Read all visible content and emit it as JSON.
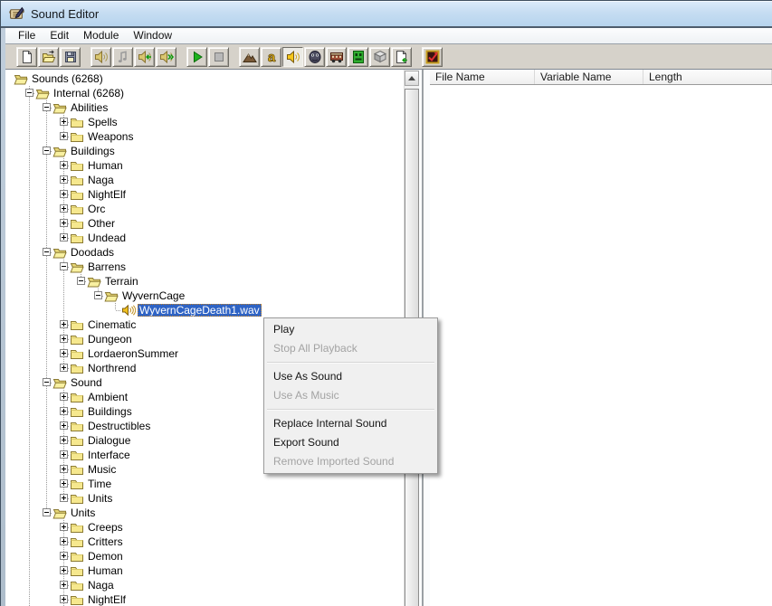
{
  "window": {
    "title": "Sound Editor"
  },
  "menu_bar": {
    "items": [
      "File",
      "Edit",
      "Module",
      "Window"
    ]
  },
  "toolbar": {
    "groups": [
      {
        "buttons": [
          {
            "name": "new-button",
            "icon": "new-document-icon",
            "pressed": false
          },
          {
            "name": "open-button",
            "icon": "open-file-icon",
            "pressed": false
          },
          {
            "name": "save-button",
            "icon": "save-icon",
            "pressed": false
          }
        ]
      },
      {
        "buttons": [
          {
            "name": "play-sound-button",
            "icon": "play-sound-icon",
            "pressed": false
          },
          {
            "name": "play-note-button",
            "icon": "music-note-icon",
            "pressed": false
          },
          {
            "name": "prev-sound-button",
            "icon": "speaker-back-icon",
            "pressed": false
          },
          {
            "name": "next-sound-button",
            "icon": "speaker-forward-icon",
            "pressed": false
          }
        ]
      },
      {
        "buttons": [
          {
            "name": "play-button",
            "icon": "play-icon",
            "pressed": false
          },
          {
            "name": "stop-button",
            "icon": "stop-icon",
            "pressed": false
          }
        ]
      },
      {
        "buttons": [
          {
            "name": "terrain-editor-button",
            "icon": "terrain-editor-icon",
            "pressed": false
          },
          {
            "name": "trigger-editor-button",
            "icon": "trigger-editor-icon",
            "pressed": false
          },
          {
            "name": "sound-editor-button",
            "icon": "sound-editor-icon",
            "pressed": true
          },
          {
            "name": "object-editor-button",
            "icon": "object-editor-icon",
            "pressed": false
          },
          {
            "name": "campaign-editor-button",
            "icon": "campaign-editor-icon",
            "pressed": false
          },
          {
            "name": "ai-editor-button",
            "icon": "ai-editor-icon",
            "pressed": false
          },
          {
            "name": "object-manager-button",
            "icon": "object-manager-icon",
            "pressed": false
          },
          {
            "name": "import-manager-button",
            "icon": "import-manager-icon",
            "pressed": false
          }
        ]
      },
      {
        "buttons": [
          {
            "name": "test-map-button",
            "icon": "test-map-icon",
            "pressed": false
          }
        ]
      }
    ]
  },
  "tree": {
    "trailing_levels": [
      1,
      3
    ],
    "rows": [
      {
        "label": "Sounds (6268)",
        "level": 0,
        "icon": "folder-open",
        "expander": "none",
        "selected": false
      },
      {
        "label": "Internal (6268)",
        "level": 1,
        "icon": "folder-open",
        "expander": "minus",
        "selected": false
      },
      {
        "label": "Abilities",
        "level": 2,
        "icon": "folder-open",
        "expander": "minus",
        "selected": false
      },
      {
        "label": "Spells",
        "level": 3,
        "icon": "folder-closed",
        "expander": "plus",
        "selected": false
      },
      {
        "label": "Weapons",
        "level": 3,
        "icon": "folder-closed",
        "expander": "plus",
        "selected": false
      },
      {
        "label": "Buildings",
        "level": 2,
        "icon": "folder-open",
        "expander": "minus",
        "selected": false
      },
      {
        "label": "Human",
        "level": 3,
        "icon": "folder-closed",
        "expander": "plus",
        "selected": false
      },
      {
        "label": "Naga",
        "level": 3,
        "icon": "folder-closed",
        "expander": "plus",
        "selected": false
      },
      {
        "label": "NightElf",
        "level": 3,
        "icon": "folder-closed",
        "expander": "plus",
        "selected": false
      },
      {
        "label": "Orc",
        "level": 3,
        "icon": "folder-closed",
        "expander": "plus",
        "selected": false
      },
      {
        "label": "Other",
        "level": 3,
        "icon": "folder-closed",
        "expander": "plus",
        "selected": false
      },
      {
        "label": "Undead",
        "level": 3,
        "icon": "folder-closed",
        "expander": "plus",
        "selected": false
      },
      {
        "label": "Doodads",
        "level": 2,
        "icon": "folder-open",
        "expander": "minus",
        "selected": false
      },
      {
        "label": "Barrens",
        "level": 3,
        "icon": "folder-open",
        "expander": "minus",
        "selected": false
      },
      {
        "label": "Terrain",
        "level": 4,
        "icon": "folder-open",
        "expander": "minus",
        "selected": false
      },
      {
        "label": "WyvernCage",
        "level": 5,
        "icon": "folder-open",
        "expander": "minus",
        "selected": false
      },
      {
        "label": "WyvernCageDeath1.wav",
        "level": 6,
        "icon": "sound-file",
        "expander": "none",
        "selected": true
      },
      {
        "label": "Cinematic",
        "level": 3,
        "icon": "folder-closed",
        "expander": "plus",
        "selected": false
      },
      {
        "label": "Dungeon",
        "level": 3,
        "icon": "folder-closed",
        "expander": "plus",
        "selected": false
      },
      {
        "label": "LordaeronSummer",
        "level": 3,
        "icon": "folder-closed",
        "expander": "plus",
        "selected": false
      },
      {
        "label": "Northrend",
        "level": 3,
        "icon": "folder-closed",
        "expander": "plus",
        "selected": false
      },
      {
        "label": "Sound",
        "level": 2,
        "icon": "folder-open",
        "expander": "minus",
        "selected": false
      },
      {
        "label": "Ambient",
        "level": 3,
        "icon": "folder-closed",
        "expander": "plus",
        "selected": false
      },
      {
        "label": "Buildings",
        "level": 3,
        "icon": "folder-closed",
        "expander": "plus",
        "selected": false
      },
      {
        "label": "Destructibles",
        "level": 3,
        "icon": "folder-closed",
        "expander": "plus",
        "selected": false
      },
      {
        "label": "Dialogue",
        "level": 3,
        "icon": "folder-closed",
        "expander": "plus",
        "selected": false
      },
      {
        "label": "Interface",
        "level": 3,
        "icon": "folder-closed",
        "expander": "plus",
        "selected": false
      },
      {
        "label": "Music",
        "level": 3,
        "icon": "folder-closed",
        "expander": "plus",
        "selected": false
      },
      {
        "label": "Time",
        "level": 3,
        "icon": "folder-closed",
        "expander": "plus",
        "selected": false
      },
      {
        "label": "Units",
        "level": 3,
        "icon": "folder-closed",
        "expander": "plus",
        "selected": false
      },
      {
        "label": "Units",
        "level": 2,
        "icon": "folder-open",
        "expander": "minus",
        "selected": false
      },
      {
        "label": "Creeps",
        "level": 3,
        "icon": "folder-closed",
        "expander": "plus",
        "selected": false
      },
      {
        "label": "Critters",
        "level": 3,
        "icon": "folder-closed",
        "expander": "plus",
        "selected": false
      },
      {
        "label": "Demon",
        "level": 3,
        "icon": "folder-closed",
        "expander": "plus",
        "selected": false
      },
      {
        "label": "Human",
        "level": 3,
        "icon": "folder-closed",
        "expander": "plus",
        "selected": false
      },
      {
        "label": "Naga",
        "level": 3,
        "icon": "folder-closed",
        "expander": "plus",
        "selected": false
      },
      {
        "label": "NightElf",
        "level": 3,
        "icon": "folder-closed",
        "expander": "plus",
        "selected": false
      }
    ]
  },
  "list": {
    "columns": [
      "File Name",
      "Variable Name",
      "Length"
    ]
  },
  "context_menu": {
    "items": [
      {
        "label": "Play",
        "enabled": true
      },
      {
        "label": "Stop All Playback",
        "enabled": false
      },
      {
        "separator": true
      },
      {
        "label": "Use As Sound",
        "enabled": true
      },
      {
        "label": "Use As Music",
        "enabled": false
      },
      {
        "separator": true
      },
      {
        "label": "Replace Internal Sound",
        "enabled": true
      },
      {
        "label": "Export Sound",
        "enabled": true
      },
      {
        "label": "Remove Imported Sound",
        "enabled": false
      }
    ]
  },
  "colors": {
    "selection_bg": "#2e63c5",
    "selection_text": "#ffffff",
    "titlebar_top": "#dcebfa",
    "titlebar_bottom": "#b7d4ee",
    "toolbar_bg": "#d6d2ca",
    "disabled_text": "#a3a3a3"
  }
}
